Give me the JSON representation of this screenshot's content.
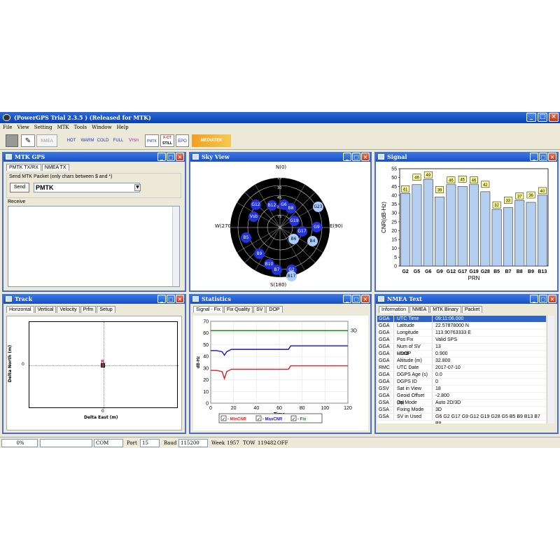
{
  "app": {
    "title": "(PowerGPS Trial 2.3.5 ) (Released for MTK)"
  },
  "menu": [
    "File",
    "View",
    "Setting",
    "MTK",
    "Tools",
    "Window",
    "Help"
  ],
  "toolbar": {
    "nmea": "NMEA",
    "hot": "HOT",
    "warm": "WARM",
    "cold": "COLD",
    "full": "FULL",
    "vrsn": "Vrsn",
    "pmtk": "PMTK",
    "fct1": "F-CT",
    "fct2": "STILL",
    "epo": "EPO",
    "brand": "MEDIATEK"
  },
  "mtk": {
    "title": "MTK GPS",
    "tabs": [
      "PMTK TX/RX",
      "NMEA TX"
    ],
    "send_group": "Send MTK Packet (only chars between $ and *)",
    "send_label": "Send",
    "packet_value": "PMTK",
    "receive_label": "Receive"
  },
  "sky": {
    "title": "Sky View",
    "north": "N(0)",
    "south": "S(180)",
    "east": "E(90)",
    "west": "W(270)",
    "ring_labels": [
      "15",
      "30",
      "45",
      "60",
      "75"
    ],
    "sats": [
      {
        "id": "G12",
        "light": false
      },
      {
        "id": "B12",
        "light": false
      },
      {
        "id": "G6",
        "light": false
      },
      {
        "id": "B8",
        "light": false
      },
      {
        "id": "G23",
        "light": true
      },
      {
        "id": "Vsb",
        "light": false
      },
      {
        "id": "G19",
        "light": false
      },
      {
        "id": "G17",
        "light": false
      },
      {
        "id": "G9",
        "light": false
      },
      {
        "id": "B5",
        "light": false
      },
      {
        "id": "B6",
        "light": true
      },
      {
        "id": "B4",
        "light": true
      },
      {
        "id": "B9",
        "light": false
      },
      {
        "id": "B10",
        "light": false
      },
      {
        "id": "B7",
        "light": false
      },
      {
        "id": "G2",
        "light": false
      },
      {
        "id": "B17",
        "light": true
      }
    ]
  },
  "signal": {
    "title": "Signal",
    "ylabel": "CNR(dB-Hz)",
    "xlabel": "PRN"
  },
  "chart_data": [
    {
      "type": "bar",
      "title": "",
      "xlabel": "PRN",
      "ylabel": "CNR(dB-Hz)",
      "ylim": [
        0,
        55
      ],
      "yticks": [
        0,
        5,
        10,
        15,
        20,
        25,
        30,
        35,
        40,
        45,
        50,
        55
      ],
      "categories": [
        "G2",
        "G5",
        "G6",
        "G9",
        "G12",
        "G17",
        "G19",
        "G28",
        "B5",
        "B7",
        "B8",
        "B9",
        "B13"
      ],
      "values": [
        41,
        46,
        49,
        39,
        46,
        45,
        46,
        42,
        32,
        33,
        37,
        36,
        40
      ]
    },
    {
      "type": "line",
      "xlabel": "Time",
      "ylabel": "dB-Hz",
      "xlim": [
        0,
        120
      ],
      "ylim": [
        0,
        70
      ],
      "xticks": [
        0,
        20,
        40,
        60,
        80,
        100,
        120
      ],
      "yticks": [
        0,
        10,
        20,
        30,
        40,
        50,
        60,
        70
      ],
      "annotation": "3D",
      "series": [
        {
          "name": "MinCNR",
          "color": "#e02020",
          "x": [
            0,
            5,
            10,
            12,
            14,
            18,
            40,
            68,
            70,
            120
          ],
          "y": [
            28,
            28,
            27,
            21,
            27,
            29,
            29,
            29,
            32,
            32
          ]
        },
        {
          "name": "MaxCNR",
          "color": "#1515c8",
          "x": [
            0,
            5,
            10,
            12,
            14,
            18,
            40,
            68,
            70,
            120
          ],
          "y": [
            45,
            45,
            44,
            41,
            44,
            46,
            46,
            46,
            49,
            49
          ]
        },
        {
          "name": "Fix",
          "color": "#108a10",
          "x": [
            0,
            120
          ],
          "y": [
            62,
            62
          ]
        }
      ]
    }
  ],
  "track": {
    "title": "Track",
    "tabs": [
      "Horizontal",
      "Vertical",
      "Velocity",
      "Prfm",
      "Setup"
    ],
    "ylabel": "Delta North (m)",
    "xlabel": "Delta East (m)",
    "zero": "0",
    "marker": "R"
  },
  "stats": {
    "title": "Statistics",
    "tabs": [
      "Signal - Fix",
      "Fix Quality",
      "SV",
      "DOP"
    ]
  },
  "nmea": {
    "title": "NMEA Text",
    "tabs": [
      "Information",
      "NMEA",
      "MTK Binary",
      "Packet"
    ],
    "rows": [
      [
        "GGA",
        "UTC Time",
        "09:11:06.000"
      ],
      [
        "GGA",
        "Latitude",
        "22.57878000 N"
      ],
      [
        "GGA",
        "Longitude",
        "113.90763333 E"
      ],
      [
        "GGA",
        "Pos Fix",
        "Valid SPS"
      ],
      [
        "GGA",
        "Num of SV Used",
        "13"
      ],
      [
        "GGA",
        "HDOP",
        "0.900"
      ],
      [
        "GGA",
        "Altitude (m)",
        "32.800"
      ],
      [
        "RMC",
        "UTC Date",
        "2017-07-10"
      ],
      [
        "GGA",
        "DGPS Age (s)",
        "0.0"
      ],
      [
        "GGA",
        "DGPS ID",
        "0"
      ],
      [
        "GSV",
        "Sat in View",
        "18"
      ],
      [
        "GGA",
        "Geoid Offset (m)",
        "-2.800"
      ],
      [
        "GSA",
        "Op Mode",
        "Auto 2D/3D"
      ],
      [
        "GSA",
        "Fixing Mode",
        "3D"
      ],
      [
        "GSA",
        "SV in Used",
        "G6 G2 G17 G9 G12 G19 G28 G5 B5 B9 B13 B7 B8"
      ]
    ]
  },
  "statusbar": {
    "progress": "0%",
    "com": "COM",
    "port_label": "Port",
    "port_value": "15",
    "baud_label": "Baud",
    "baud_value": "115200",
    "week_label": "Week",
    "week_value": "1957",
    "tow_label": "TOW",
    "tow_value": "119482",
    "off": "OFF"
  }
}
